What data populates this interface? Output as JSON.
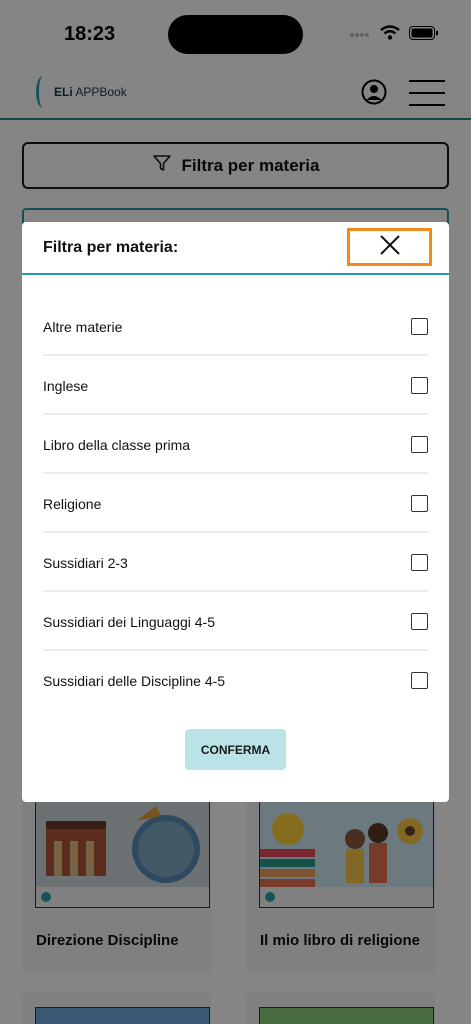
{
  "status_bar": {
    "time": "18:23"
  },
  "header": {
    "logo_prefix": "ELi",
    "logo_name": "APPBook"
  },
  "filter_button": {
    "label": "Filtra per materia"
  },
  "cards": [
    {
      "title": "Direzione Discipline"
    },
    {
      "title": "Il mio libro di religione"
    }
  ],
  "modal": {
    "title": "Filtra per materia:",
    "options": [
      {
        "label": "Altre materie",
        "checked": false
      },
      {
        "label": "Inglese",
        "checked": false
      },
      {
        "label": "Libro della classe prima",
        "checked": false
      },
      {
        "label": "Religione",
        "checked": false
      },
      {
        "label": "Sussidiari 2-3",
        "checked": false
      },
      {
        "label": "Sussidiari dei Linguaggi 4-5",
        "checked": false
      },
      {
        "label": "Sussidiari delle Discipline 4-5",
        "checked": false
      }
    ],
    "confirm_label": "CONFERMA"
  },
  "colors": {
    "accent": "#2a9aa3",
    "highlight": "#f28a1e",
    "confirm_bg": "#b9e3e6"
  }
}
